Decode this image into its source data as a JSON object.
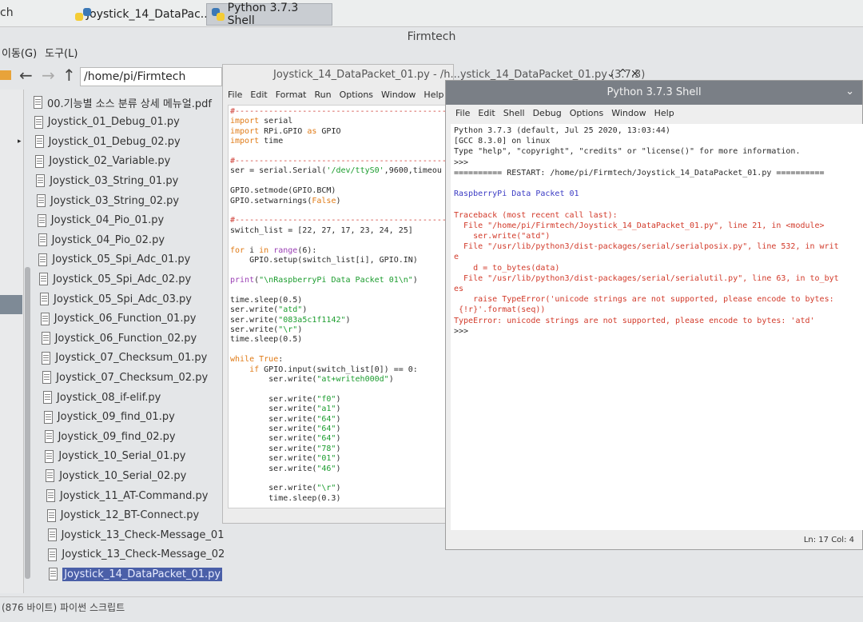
{
  "taskbar": {
    "left_text": "ch",
    "tasks": [
      {
        "label": "Joystick_14_DataPac..."
      },
      {
        "label": "Python 3.7.3 Shell"
      }
    ]
  },
  "file_manager": {
    "title": "Firmtech",
    "menu": [
      "이동(G)",
      "도구(L)"
    ],
    "path": "/home/pi/Firmtech",
    "files": [
      "00.기능별 소스 분류 상세 메뉴얼.pdf",
      "Joystick_01_Debug_01.py",
      "Joystick_01_Debug_02.py",
      "Joystick_02_Variable.py",
      "Joystick_03_String_01.py",
      "Joystick_03_String_02.py",
      "Joystick_04_Pio_01.py",
      "Joystick_04_Pio_02.py",
      "Joystick_05_Spi_Adc_01.py",
      "Joystick_05_Spi_Adc_02.py",
      "Joystick_05_Spi_Adc_03.py",
      "Joystick_06_Function_01.py",
      "Joystick_06_Function_02.py",
      "Joystick_07_Checksum_01.py",
      "Joystick_07_Checksum_02.py",
      "Joystick_08_if-elif.py",
      "Joystick_09_find_01.py",
      "Joystick_09_find_02.py",
      "Joystick_10_Serial_01.py",
      "Joystick_10_Serial_02.py",
      "Joystick_11_AT-Command.py",
      "Joystick_12_BT-Connect.py",
      "Joystick_13_Check-Message_01.py",
      "Joystick_13_Check-Message_02.py",
      "Joystick_14_DataPacket_01.py"
    ],
    "status": "(876 바이트) 파이썬 스크립트"
  },
  "editor": {
    "title": "Joystick_14_DataPacket_01.py - /h...ystick_14_DataPacket_01.py (3.7.3)",
    "menu": [
      "File",
      "Edit",
      "Format",
      "Run",
      "Options",
      "Window",
      "Help"
    ],
    "lines": [
      "#----------------------------------------------------",
      "import serial",
      "import RPi.GPIO as GPIO",
      "import time",
      "",
      "#----------------------------------------------------",
      "ser = serial.Serial('/dev/ttyS0',9600,timeou",
      "",
      "GPIO.setmode(GPIO.BCM)",
      "GPIO.setwarnings(False)",
      "",
      "#----------------------------------------------------",
      "switch_list = [22, 27, 17, 23, 24, 25]",
      "",
      "for i in range(6):",
      "    GPIO.setup(switch_list[i], GPIO.IN)",
      "",
      "print(\"\\nRaspberryPi Data Packet 01\\n\")",
      "",
      "time.sleep(0.5)",
      "ser.write(\"atd\")",
      "ser.write(\"083a5c1f1142\")",
      "ser.write(\"\\r\")",
      "time.sleep(0.5)",
      "",
      "while True:",
      "    if GPIO.input(switch_list[0]) == 0:",
      "        ser.write(\"at+writeh000d\")",
      "",
      "        ser.write(\"f0\")",
      "        ser.write(\"a1\")",
      "        ser.write(\"64\")",
      "        ser.write(\"64\")",
      "        ser.write(\"64\")",
      "        ser.write(\"78\")",
      "        ser.write(\"01\")",
      "        ser.write(\"46\")",
      "",
      "        ser.write(\"\\r\")",
      "        time.sleep(0.3)"
    ]
  },
  "shell": {
    "title": "Python 3.7.3 Shell",
    "menu": [
      "File",
      "Edit",
      "Shell",
      "Debug",
      "Options",
      "Window",
      "Help"
    ],
    "lines": [
      {
        "t": "Python 3.7.3 (default, Jul 25 2020, 13:03:44)",
        "c": ""
      },
      {
        "t": "[GCC 8.3.0] on linux",
        "c": ""
      },
      {
        "t": "Type \"help\", \"copyright\", \"credits\" or \"license()\" for more information.",
        "c": ""
      },
      {
        "t": ">>>",
        "c": ""
      },
      {
        "t": "========== RESTART: /home/pi/Firmtech/Joystick_14_DataPacket_01.py ==========",
        "c": ""
      },
      {
        "t": "",
        "c": ""
      },
      {
        "t": "RaspberryPi Data Packet 01",
        "c": "out"
      },
      {
        "t": "",
        "c": ""
      },
      {
        "t": "Traceback (most recent call last):",
        "c": "err"
      },
      {
        "t": "  File \"/home/pi/Firmtech/Joystick_14_DataPacket_01.py\", line 21, in <module>",
        "c": "err"
      },
      {
        "t": "    ser.write(\"atd\")",
        "c": "err"
      },
      {
        "t": "  File \"/usr/lib/python3/dist-packages/serial/serialposix.py\", line 532, in writ",
        "c": "err"
      },
      {
        "t": "e",
        "c": "err"
      },
      {
        "t": "    d = to_bytes(data)",
        "c": "err"
      },
      {
        "t": "  File \"/usr/lib/python3/dist-packages/serial/serialutil.py\", line 63, in to_byt",
        "c": "err"
      },
      {
        "t": "es",
        "c": "err"
      },
      {
        "t": "    raise TypeError('unicode strings are not supported, please encode to bytes:",
        "c": "err"
      },
      {
        "t": " {!r}'.format(seq))",
        "c": "err"
      },
      {
        "t": "TypeError: unicode strings are not supported, please encode to bytes: 'atd'",
        "c": "err"
      },
      {
        "t": ">>>",
        "c": ""
      }
    ],
    "status": "Ln: 17  Col: 4"
  }
}
